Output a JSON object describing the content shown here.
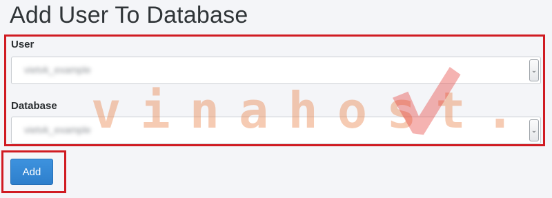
{
  "page": {
    "title": "Add User To Database"
  },
  "form": {
    "user": {
      "label": "User",
      "value": "vietvk_example",
      "arrow_icon": "chevron-down-icon"
    },
    "database": {
      "label": "Database",
      "value": "vietvk_example",
      "arrow_icon": "chevron-down-icon"
    }
  },
  "actions": {
    "add_label": "Add"
  },
  "watermark": {
    "text": "vinahost.",
    "check_icon": "check-mark-icon"
  },
  "colors": {
    "highlight_border": "#d01b22",
    "primary_button": "#3387d6",
    "watermark": "#e9783a",
    "background": "#f4f5f8"
  }
}
